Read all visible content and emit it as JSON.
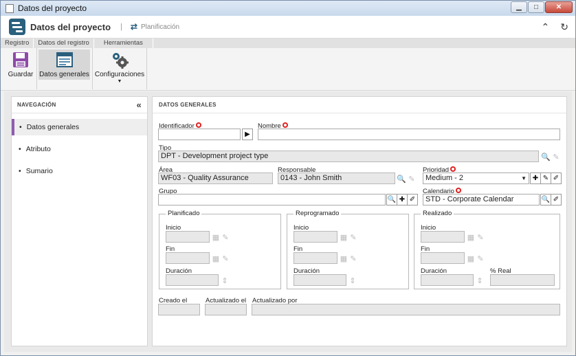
{
  "window": {
    "title": "Datos del proyecto"
  },
  "header": {
    "app_title": "Datos del proyecto",
    "breadcrumb": "Planificación"
  },
  "ribbon": {
    "tabs": [
      "Registro",
      "Datos del registro",
      "Herramientas"
    ],
    "buttons": {
      "save": "Guardar",
      "general": "Datos generales",
      "config": "Configuraciones"
    }
  },
  "nav": {
    "title": "NAVEGACIÓN",
    "items": [
      {
        "label": "Datos generales",
        "active": true
      },
      {
        "label": "Atributo",
        "active": false
      },
      {
        "label": "Sumario",
        "active": false
      }
    ]
  },
  "form": {
    "title": "DATOS GENERALES",
    "identificador": {
      "label": "Identificador",
      "value": ""
    },
    "nombre": {
      "label": "Nombre",
      "value": ""
    },
    "tipo": {
      "label": "Tipo",
      "value": "DPT - Development project type"
    },
    "area": {
      "label": "Área",
      "value": "WF03 - Quality Assurance"
    },
    "responsable": {
      "label": "Responsable",
      "value": "0143 - John Smith"
    },
    "prioridad": {
      "label": "Prioridad",
      "value": "Medium - 2"
    },
    "grupo": {
      "label": "Grupo",
      "value": ""
    },
    "calendario": {
      "label": "Calendario",
      "value": "STD - Corporate Calendar"
    },
    "planificado": {
      "title": "Planificado",
      "inicio": "Inicio",
      "fin": "Fin",
      "duracion": "Duración"
    },
    "reprogramado": {
      "title": "Reprogramado",
      "inicio": "Inicio",
      "fin": "Fin",
      "duracion": "Duración"
    },
    "realizado": {
      "title": "Realizado",
      "inicio": "Inicio",
      "fin": "Fin",
      "duracion": "Duración",
      "real": "% Real"
    },
    "creado": {
      "label": "Creado el",
      "value": ""
    },
    "actualizado": {
      "label": "Actualizado el",
      "value": ""
    },
    "actualizado_por": {
      "label": "Actualizado por",
      "value": ""
    }
  },
  "colors": {
    "accent": "#8e5db0",
    "brand": "#2a5f7d",
    "required": "#e02020"
  }
}
